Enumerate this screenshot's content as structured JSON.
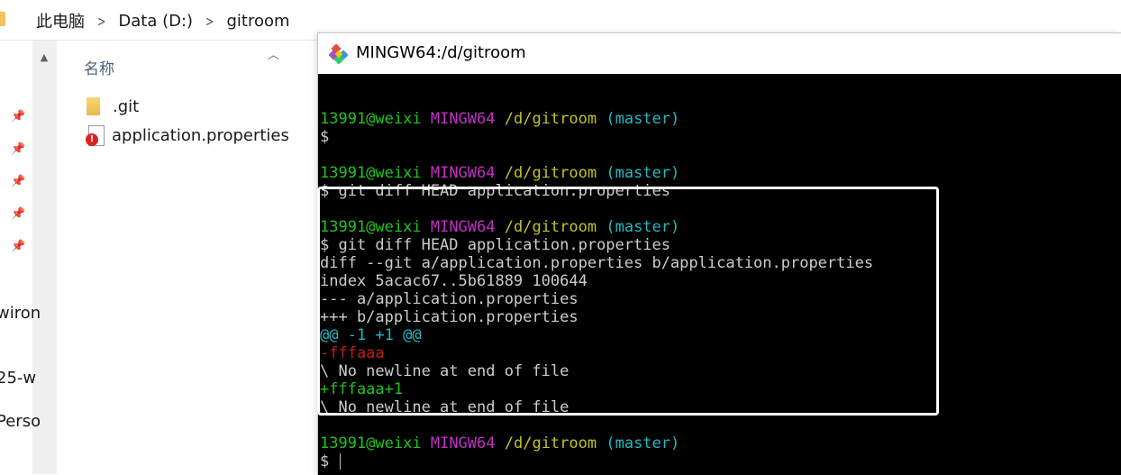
{
  "explorer": {
    "breadcrumbs": [
      "此电脑",
      "Data (D:)",
      "gitroom"
    ],
    "breadcrumb_separator": ">",
    "column_name": "名称",
    "files": [
      {
        "name": ".git",
        "icon": "folder-icon"
      },
      {
        "name": "application.properties",
        "icon": "properties-file-icon"
      }
    ],
    "nav_fragments": [
      "wiron",
      "25-w",
      "Perso"
    ]
  },
  "terminal": {
    "title": "MINGW64:/d/gitroom",
    "prompt": {
      "user": "13991@weixi",
      "env": "MINGW64",
      "path": "/d/gitroom",
      "branch": "(master)"
    },
    "lines": [
      {
        "type": "blank"
      },
      {
        "type": "prompt"
      },
      {
        "type": "text",
        "text": "$",
        "color": "white"
      },
      {
        "type": "blank"
      },
      {
        "type": "prompt"
      },
      {
        "type": "text",
        "text": "$ git diff HEAD application.properties",
        "color": "white"
      },
      {
        "type": "blank"
      },
      {
        "type": "prompt"
      },
      {
        "type": "text",
        "text": "$ git diff HEAD application.properties",
        "color": "white"
      },
      {
        "type": "text",
        "text": "diff --git a/application.properties b/application.properties",
        "color": "white"
      },
      {
        "type": "text",
        "text": "index 5acac67..5b61889 100644",
        "color": "white"
      },
      {
        "type": "text",
        "text": "--- a/application.properties",
        "color": "white"
      },
      {
        "type": "text",
        "text": "+++ b/application.properties",
        "color": "white"
      },
      {
        "type": "text",
        "text": "@@ -1 +1 @@",
        "color": "cyan"
      },
      {
        "type": "text",
        "text": "-fffaaa",
        "color": "red"
      },
      {
        "type": "text",
        "text": "\\ No newline at end of file",
        "color": "white"
      },
      {
        "type": "text",
        "text": "+fffaaa+1",
        "color": "green"
      },
      {
        "type": "text",
        "text": "\\ No newline at end of file",
        "color": "white"
      },
      {
        "type": "blank"
      },
      {
        "type": "prompt"
      },
      {
        "type": "text",
        "text": "$",
        "color": "white",
        "cursor": true
      }
    ]
  },
  "colors": {
    "prompt_user": "#1fc41f",
    "prompt_env": "#c32fc3",
    "prompt_path": "#c2c322",
    "prompt_branch": "#22b9c2",
    "diff_removed": "#c21e1e",
    "diff_added": "#1fc41f",
    "highlight_border": "#ffffff"
  }
}
